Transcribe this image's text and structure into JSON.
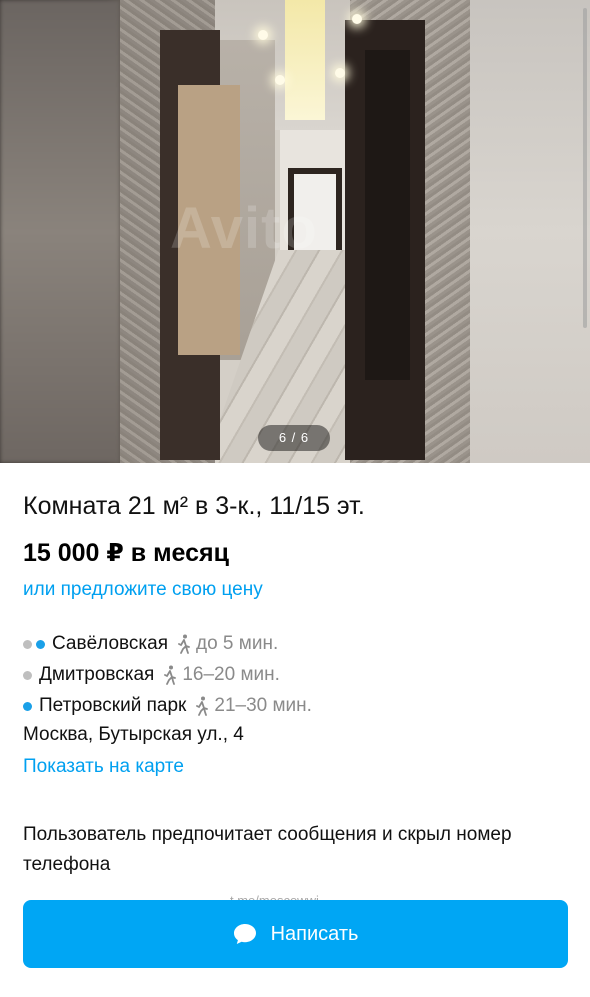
{
  "gallery": {
    "counter": "6 / 6",
    "watermark": "Avito"
  },
  "listing": {
    "title": "Комната 21 м² в 3-к., 11/15 эт.",
    "price": "15 000 ₽ в месяц",
    "offer_link": "или предложите свою цену"
  },
  "metro": [
    {
      "dots": [
        "gray",
        "blue"
      ],
      "name": "Савёловская",
      "walk_time": "до 5 мин."
    },
    {
      "dots": [
        "gray"
      ],
      "name": "Дмитровская",
      "walk_time": "16–20 мин."
    },
    {
      "dots": [
        "blue"
      ],
      "name": "Петровский парк",
      "walk_time": "21–30 мин."
    }
  ],
  "address": "Москва, Бутырская ул., 4",
  "map_link": "Показать на карте",
  "contact_note": "Пользователь предпочитает сообщения и скрыл номер телефона",
  "ghost_text": "t.me/moscowwi",
  "write_button": {
    "label": "Написать",
    "icon": "chat-bubble-icon"
  },
  "colors": {
    "accent": "#00a6f4",
    "link": "#00a0f0",
    "dot_gray": "#bfbfbf",
    "dot_blue": "#1aa0e8",
    "muted": "#8a8a8a"
  }
}
